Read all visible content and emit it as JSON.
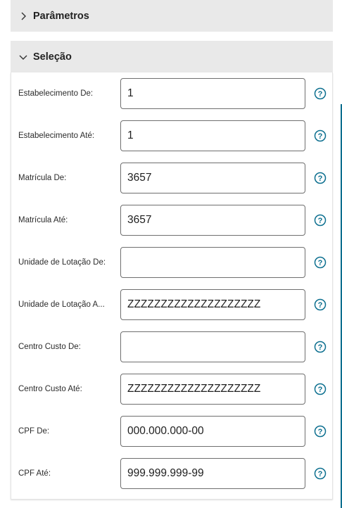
{
  "sections": {
    "parametros": {
      "title": "Parâmetros",
      "expanded": false
    },
    "selecao": {
      "title": "Seleção",
      "expanded": true
    }
  },
  "fields": [
    {
      "label": "Estabelecimento De:",
      "value": "1"
    },
    {
      "label": "Estabelecimento Até:",
      "value": "1"
    },
    {
      "label": "Matrícula De:",
      "value": "3657"
    },
    {
      "label": "Matrícula Até:",
      "value": "3657"
    },
    {
      "label": "Unidade de Lotação De:",
      "value": ""
    },
    {
      "label": "Unidade de Lotação A...",
      "value": "ZZZZZZZZZZZZZZZZZZZZ"
    },
    {
      "label": "Centro Custo De:",
      "value": ""
    },
    {
      "label": "Centro Custo Até:",
      "value": "ZZZZZZZZZZZZZZZZZZZZ"
    },
    {
      "label": "CPF De:",
      "value": "000.000.000-00"
    },
    {
      "label": "CPF Até:",
      "value": "999.999.999-99"
    }
  ],
  "icons": {
    "collapsed": "chevron-right-icon",
    "expanded": "chevron-down-icon",
    "help": "help-circle-icon"
  },
  "colors": {
    "accent": "#0c6f8f",
    "header_bg": "#e9e9e9",
    "field_border": "#6f6f6f"
  }
}
